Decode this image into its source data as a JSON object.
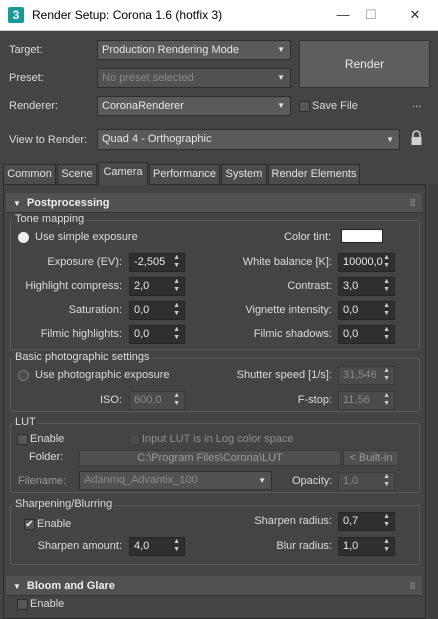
{
  "window": {
    "title": "Render Setup: Corona 1.6 (hotfix 3)",
    "app_icon": "3",
    "minimize": "—",
    "maximize": "☐",
    "close": "✕"
  },
  "top": {
    "target": {
      "label": "Target:",
      "value": "Production Rendering Mode"
    },
    "preset": {
      "label": "Preset:",
      "placeholder": "No preset selected"
    },
    "renderer": {
      "label": "Renderer:",
      "value": "CoronaRenderer"
    },
    "save_file": {
      "label": "Save File",
      "checked": false
    },
    "ellipsis": "...",
    "view": {
      "label": "View to Render:",
      "value": "Quad 4 - Orthographic"
    },
    "render_button": "Render"
  },
  "tabs": [
    {
      "label": "Common"
    },
    {
      "label": "Scene"
    },
    {
      "label": "Camera"
    },
    {
      "label": "Performance"
    },
    {
      "label": "System"
    },
    {
      "label": "Render Elements"
    }
  ],
  "active_tab": "Camera",
  "postprocessing": {
    "title": "Postprocessing",
    "tone": {
      "group": "Tone mapping",
      "simple_exposure": "Use simple exposure",
      "color_tint": "Color tint:",
      "color_tint_value": "#ffffff",
      "exposure": {
        "label": "Exposure (EV):",
        "value": "-2,505"
      },
      "white_balance": {
        "label": "White balance [K]:",
        "value": "10000,0"
      },
      "highlight": {
        "label": "Highlight compress:",
        "value": "2,0"
      },
      "contrast": {
        "label": "Contrast:",
        "value": "3,0"
      },
      "saturation": {
        "label": "Saturation:",
        "value": "0,0"
      },
      "vignette": {
        "label": "Vignette intensity:",
        "value": "0,0"
      },
      "filmic_high": {
        "label": "Filmic highlights:",
        "value": "0,0"
      },
      "filmic_shadow": {
        "label": "Filmic shadows:",
        "value": "0,0"
      }
    },
    "photo": {
      "group": "Basic photographic settings",
      "use_photo": "Use photographic exposure",
      "shutter": {
        "label": "Shutter speed [1/s]:",
        "value": "31,546"
      },
      "iso": {
        "label": "ISO:",
        "value": "600,0"
      },
      "fstop": {
        "label": "F-stop:",
        "value": "11,56"
      }
    },
    "lut": {
      "group": "LUT",
      "enable": "Enable",
      "log": "Input LUT is in Log color space",
      "folder_label": "Folder:",
      "folder_value": "C:\\Program Files\\Corona\\LUT",
      "builtin": "< Built-in",
      "filename_label": "Filename:",
      "filename_value": "Adanmq_Advantix_100",
      "opacity": {
        "label": "Opacity:",
        "value": "1,0"
      }
    },
    "sharpen": {
      "group": "Sharpening/Blurring",
      "enable": "Enable",
      "enabled": true,
      "sharpen_radius": {
        "label": "Sharpen radius:",
        "value": "0,7"
      },
      "sharpen_amount": {
        "label": "Sharpen amount:",
        "value": "4,0"
      },
      "blur_radius": {
        "label": "Blur radius:",
        "value": "1,0"
      }
    }
  },
  "bloom": {
    "title": "Bloom and Glare",
    "enable": "Enable"
  },
  "icons": {
    "grip": "⠿",
    "collapse": "▼",
    "lock": "lock-icon"
  }
}
